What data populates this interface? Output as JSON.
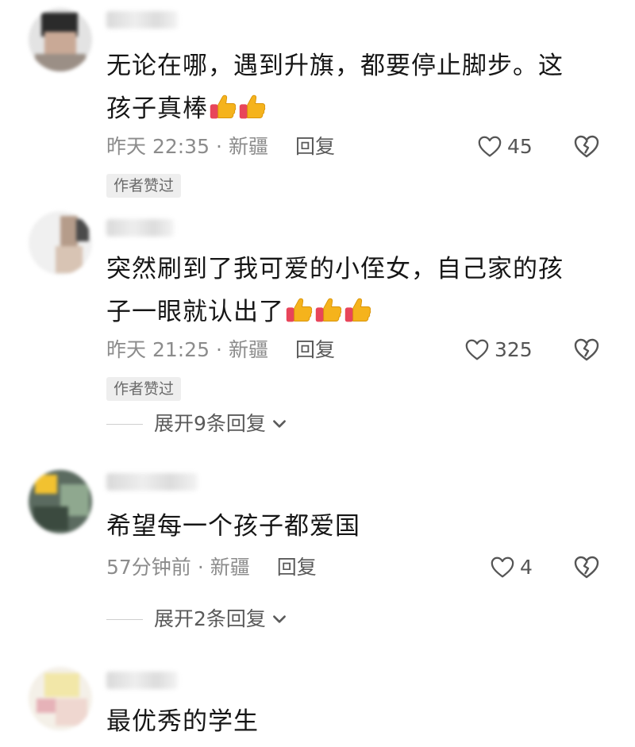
{
  "comments": [
    {
      "line1": "无论在哪，遇到升旗，都要停止脚步。这",
      "line2": "孩子真棒",
      "emoji_count": 2,
      "time": "昨天 22:35",
      "location": "新疆",
      "reply_label": "回复",
      "likes": "45",
      "badge": "作者赞过"
    },
    {
      "line1": "突然刷到了我可爱的小侄女，自己家的孩",
      "line2": "子一眼就认出了",
      "emoji_count": 3,
      "time": "昨天 21:25",
      "location": "新疆",
      "reply_label": "回复",
      "likes": "325",
      "badge": "作者赞过",
      "expand": "展开9条回复"
    },
    {
      "line1": "希望每一个孩子都爱国",
      "time": "57分钟前",
      "location": "新疆",
      "reply_label": "回复",
      "likes": "4",
      "expand": "展开2条回复"
    },
    {
      "line1": "最优秀的学生"
    }
  ],
  "separator": "·",
  "icons": {
    "like": "heart-outline-icon",
    "dislike": "broken-heart-icon",
    "expand": "chevron-down-icon",
    "thumbs": "thumbs-up-emoji"
  }
}
